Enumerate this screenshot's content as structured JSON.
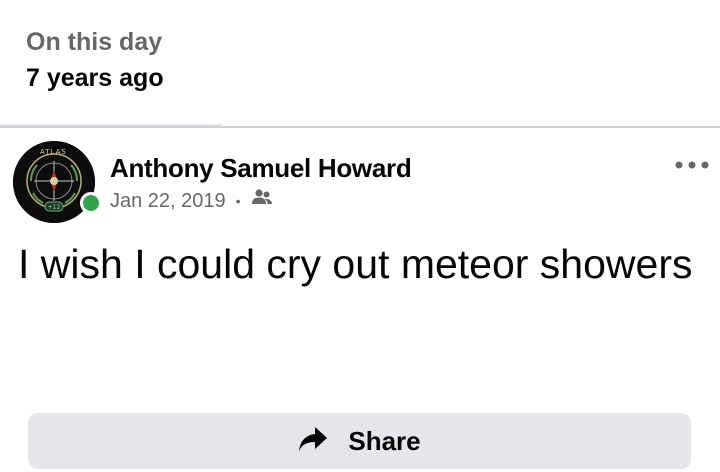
{
  "memory": {
    "label": "On this day",
    "years_ago": "7 years ago"
  },
  "post": {
    "author": "Anthony Samuel Howard",
    "date": "Jan 22, 2019",
    "separator": "•",
    "audience_icon": "friends-icon",
    "text": "I wish I could cry out meteor showers",
    "avatar_badge_text": "ATLAS",
    "online": true
  },
  "actions": {
    "more_icon": "more-options-icon",
    "share_label": "Share",
    "share_icon": "share-arrow-icon"
  },
  "colors": {
    "secondary_text": "#65676b",
    "primary_text": "#050505",
    "online_green": "#31a24c",
    "button_bg": "#e4e6eb"
  }
}
